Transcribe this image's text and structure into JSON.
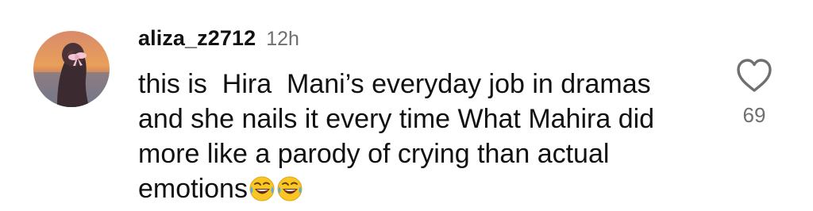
{
  "comment": {
    "username": "aliza_z2712",
    "timestamp": "12h",
    "text": "this is  Hira  Mani’s everyday job in dramas and she nails it every time What Mahira did more like a parody of crying than actual emotions",
    "emojis": [
      "🤣",
      "🤣"
    ],
    "like_count": "69",
    "like_icon": "heart-outline-icon"
  },
  "colors": {
    "text": "#111111",
    "secondary": "#6f6f6f",
    "background": "#ffffff"
  }
}
